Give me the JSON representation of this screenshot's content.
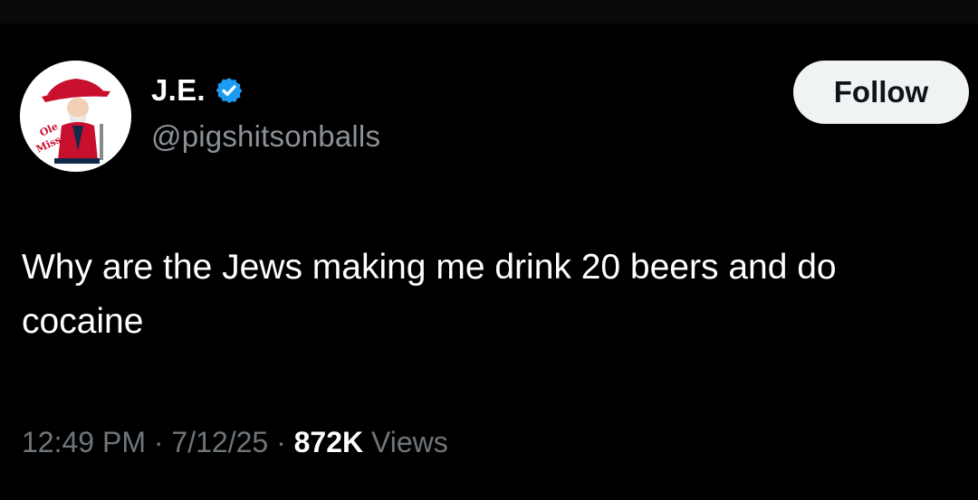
{
  "author": {
    "display_name": "J.E.",
    "handle": "@pigshitsonballs",
    "verified": true,
    "avatar_icon": "colonel-mascot-avatar-icon",
    "avatar_text": "Ole Miss"
  },
  "follow_button": {
    "label": "Follow"
  },
  "tweet": {
    "text": "Why are the Jews making me drink 20 beers and do cocaine"
  },
  "meta": {
    "time": "12:49 PM",
    "separator": "·",
    "date": "7/12/25",
    "views_count": "872K",
    "views_label": "Views"
  },
  "colors": {
    "background": "#000000",
    "primary_text": "#ffffff",
    "secondary_text": "#8b9197",
    "verified_badge": "#1d9bf0",
    "follow_button_bg": "#eff3f4",
    "follow_button_text": "#0f1419"
  }
}
